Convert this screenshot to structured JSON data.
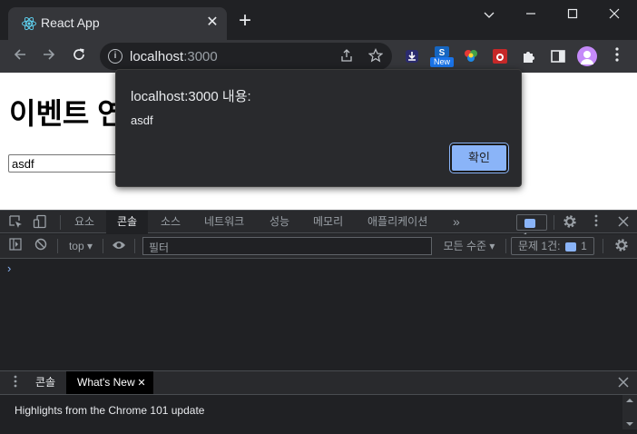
{
  "browser": {
    "tab_title": "React App",
    "new_tab_symbol": "+",
    "close_tab_symbol": "✕",
    "url_host": "localhost",
    "url_port": ":3000",
    "new_badge": "New"
  },
  "page": {
    "heading": "이벤트 연",
    "input_value": "asdf"
  },
  "alert": {
    "title": "localhost:3000 내용:",
    "message": "asdf",
    "ok_label": "확인"
  },
  "devtools": {
    "tabs": [
      "요소",
      "콘솔",
      "소스",
      "네트워크",
      "성능",
      "메모리",
      "애플리케이션"
    ],
    "active_tab": "콘솔",
    "more_tabs": "»",
    "message_count": "1",
    "context": "top",
    "filter_placeholder": "필터",
    "level": "모든 수준",
    "issues_label": "문제 1건:",
    "issues_count": "1",
    "prompt": "›",
    "drawer_tabs": [
      "콘솔",
      "What's New"
    ],
    "drawer_active": "What's New",
    "drawer_text": "Highlights from the Chrome 101 update"
  },
  "colors": {
    "accent": "#8ab4f8",
    "chrome_dark": "#202124",
    "toolbar": "#35363a"
  }
}
